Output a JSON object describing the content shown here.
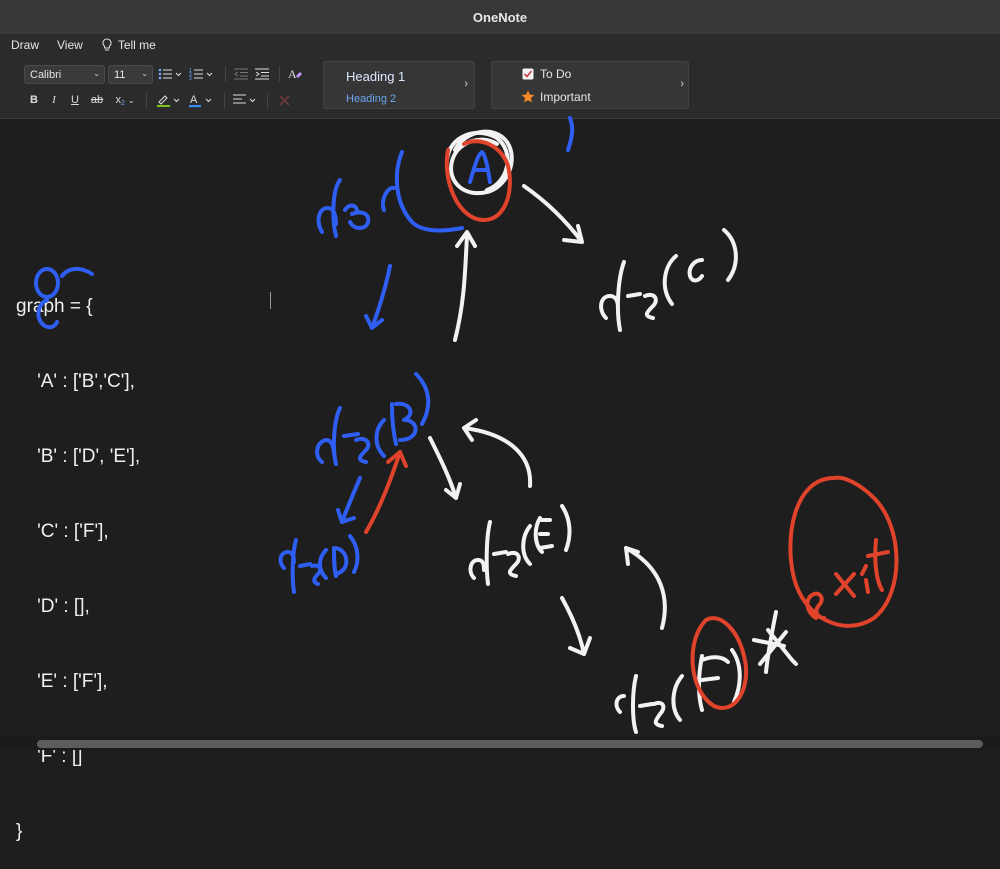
{
  "window": {
    "title": "OneNote"
  },
  "menu": {
    "draw": "Draw",
    "view": "View",
    "tell_me": "Tell me"
  },
  "ribbon": {
    "font_name": "Calibri",
    "font_size": "11",
    "bold": "B",
    "italic": "I",
    "underline": "U",
    "strike": "ab",
    "subscript": "x",
    "styles": {
      "heading1": "Heading 1",
      "heading2": "Heading 2"
    },
    "tags": {
      "todo": "To Do",
      "important": "Important"
    }
  },
  "note": {
    "code_lines": [
      "graph = {",
      "    'A' : ['B','C'],",
      "    'B' : ['D', 'E'],",
      "    'C' : ['F'],",
      "    'D' : [],",
      "    'E' : ['F'],",
      "    'F' : []",
      "}"
    ]
  },
  "ink": {
    "colors": {
      "blue": "#2f5ef2",
      "white": "#f2f2f2",
      "red": "#e0432b"
    },
    "handwriting": [
      "dfs(A)",
      "dfs(C)",
      "dfs(B)",
      "dfs(D)",
      "dfs(E)",
      "dfs(F)",
      "exit"
    ]
  }
}
